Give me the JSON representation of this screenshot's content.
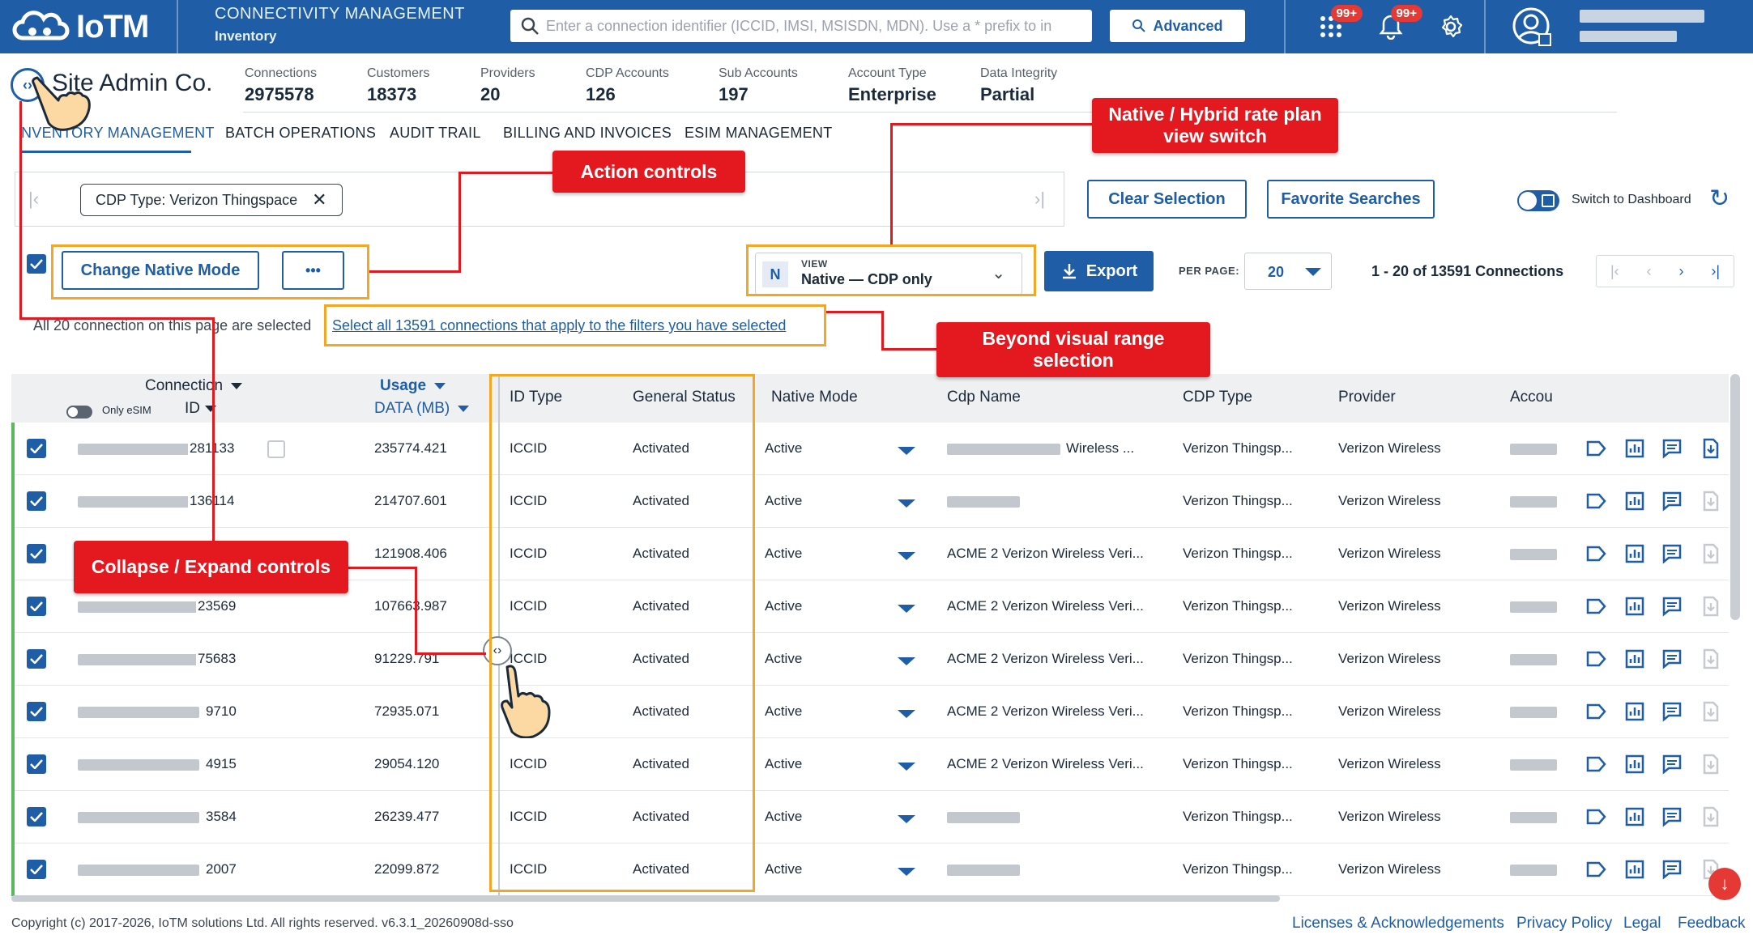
{
  "app": {
    "brand": "IoTM",
    "section": "CONNECTIVITY MANAGEMENT",
    "subsection": "Inventory",
    "search_placeholder": "Enter a connection identifier (ICCID, IMSI, MSISDN, MDN). Use a * prefix to in",
    "advanced_label": "Advanced",
    "apps_badge": "99+",
    "notif_badge": "99+"
  },
  "account": {
    "name": "Site Admin Co.",
    "stats": [
      {
        "label": "Connections",
        "value": "2975578"
      },
      {
        "label": "Customers",
        "value": "18373"
      },
      {
        "label": "Providers",
        "value": "20"
      },
      {
        "label": "CDP Accounts",
        "value": "126"
      },
      {
        "label": "Sub Accounts",
        "value": "197"
      },
      {
        "label": "Account Type",
        "value": "Enterprise"
      },
      {
        "label": "Data Integrity",
        "value": "Partial"
      }
    ]
  },
  "tabs": [
    {
      "label": "NVENTORY MANAGEMENT",
      "active": true
    },
    {
      "label": "BATCH OPERATIONS"
    },
    {
      "label": "AUDIT TRAIL"
    },
    {
      "label": "BILLING AND INVOICES"
    },
    {
      "label": "ESIM MANAGEMENT"
    }
  ],
  "filters": {
    "chip": "CDP Type: Verizon Thingspace",
    "clear_selection": "Clear Selection",
    "favorite_searches": "Favorite Searches",
    "switch_dashboard": "Switch to Dashboard"
  },
  "actions": {
    "change_native_mode": "Change Native Mode",
    "more": "•••",
    "view_label": "VIEW",
    "view_badge": "N",
    "view_value": "Native — CDP only",
    "export": "Export",
    "per_page_label": "PER PAGE:",
    "per_page_value": "20",
    "range_text": "1 - 20 of 13591 Connections"
  },
  "selection": {
    "message": "All 20 connection on this page are selected",
    "select_all_link": "Select all 13591 connections that apply to the filters you have selected"
  },
  "table": {
    "headers": {
      "connection": "Connection",
      "only_esim": "Only eSIM",
      "id": "ID",
      "usage": "Usage",
      "data_mb": "DATA (MB)",
      "id_type": "ID Type",
      "general_status": "General Status",
      "native_mode": "Native Mode",
      "cdp_name": "Cdp Name",
      "cdp_type": "CDP Type",
      "provider": "Provider",
      "account": "Accou"
    },
    "rows": [
      {
        "id_suffix": "281133",
        "usage": "235774.421",
        "id_type": "ICCID",
        "status": "Activated",
        "native_mode": "Active",
        "cdp_name": "Wireless ...",
        "cdp_type": "Verizon Thingsp...",
        "provider": "Verizon Wireless"
      },
      {
        "id_suffix": "136114",
        "usage": "214707.601",
        "id_type": "ICCID",
        "status": "Activated",
        "native_mode": "Active",
        "cdp_name": "",
        "cdp_type": "Verizon Thingsp...",
        "provider": "Verizon Wireless"
      },
      {
        "id_suffix": "",
        "usage": "121908.406",
        "id_type": "ICCID",
        "status": "Activated",
        "native_mode": "Active",
        "cdp_name": "ACME 2 Verizon Wireless Veri...",
        "cdp_type": "Verizon Thingsp...",
        "provider": "Verizon Wireless"
      },
      {
        "id_suffix": "23569",
        "usage": "107663.987",
        "id_type": "ICCID",
        "status": "Activated",
        "native_mode": "Active",
        "cdp_name": "ACME 2 Verizon Wireless Veri...",
        "cdp_type": "Verizon Thingsp...",
        "provider": "Verizon Wireless"
      },
      {
        "id_suffix": "75683",
        "usage": "91229.791",
        "id_type": "ICCID",
        "status": "Activated",
        "native_mode": "Active",
        "cdp_name": "ACME 2 Verizon Wireless Veri...",
        "cdp_type": "Verizon Thingsp...",
        "provider": "Verizon Wireless"
      },
      {
        "id_suffix": "9710",
        "usage": "72935.071",
        "id_type": "IC",
        "status": "Activated",
        "native_mode": "Active",
        "cdp_name": "ACME 2 Verizon Wireless Veri...",
        "cdp_type": "Verizon Thingsp...",
        "provider": "Verizon Wireless"
      },
      {
        "id_suffix": "4915",
        "usage": "29054.120",
        "id_type": "ICCID",
        "status": "Activated",
        "native_mode": "Active",
        "cdp_name": "ACME 2 Verizon Wireless Veri...",
        "cdp_type": "Verizon Thingsp...",
        "provider": "Verizon Wireless"
      },
      {
        "id_suffix": "3584",
        "usage": "26239.477",
        "id_type": "ICCID",
        "status": "Activated",
        "native_mode": "Active",
        "cdp_name": "",
        "cdp_type": "Verizon Thingsp...",
        "provider": "Verizon Wireless"
      },
      {
        "id_suffix": "2007",
        "usage": "22099.872",
        "id_type": "ICCID",
        "status": "Activated",
        "native_mode": "Active",
        "cdp_name": "",
        "cdp_type": "Verizon Thingsp...",
        "provider": "Verizon Wireless"
      }
    ]
  },
  "footer": {
    "copyright": "Copyright (c) 2017-2026, IoTM solutions Ltd. All rights reserved. v6.3.1_20260908d-sso",
    "links": [
      "Licenses & Acknowledgements",
      "Privacy Policy",
      "Legal",
      "Feedback"
    ]
  },
  "annotations": {
    "action_controls": "Action controls",
    "view_switch": "Native / Hybrid rate plan view switch",
    "beyond_range": "Beyond visual range selection",
    "collapse_expand": "Collapse / Expand controls"
  },
  "colors": {
    "primary": "#1f5ea6",
    "callout_red": "#e3191f",
    "highlight_orange": "#f5a623",
    "active_green": "#5cb85c"
  }
}
